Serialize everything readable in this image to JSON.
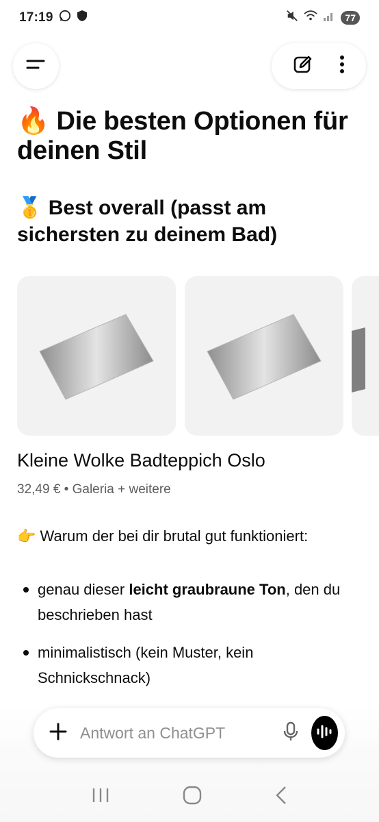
{
  "status_bar": {
    "time": "17:19",
    "battery": "77"
  },
  "header": {
    "menu_icon": "menu-icon",
    "edit_icon": "edit-icon",
    "more_icon": "more-vertical-icon"
  },
  "article": {
    "title": "🔥 Die besten Optionen für deinen Stil",
    "section_title": "🥇 Best overall (passt am sichersten zu deinem Bad)",
    "product": {
      "name": "Kleine Wolke Badteppich Oslo",
      "meta": "32,49 € • Galeria + weitere"
    },
    "why_heading": "👉 Warum der bei dir brutal gut funktioniert:",
    "bullets": [
      {
        "before": "genau dieser ",
        "bold": "leicht graubraune Ton",
        "after": ", den du beschrieben hast"
      },
      {
        "before": "minimalistisch (kein Muster, kein Schnickschnack)",
        "bold": "",
        "after": ""
      }
    ]
  },
  "composer": {
    "placeholder": "Antwort an ChatGPT"
  },
  "colors": {
    "accent": "#000000",
    "card_bg": "#f2f2f2",
    "rug_gray": "#9a9a9a",
    "rug_light": "#e2e2e2"
  }
}
